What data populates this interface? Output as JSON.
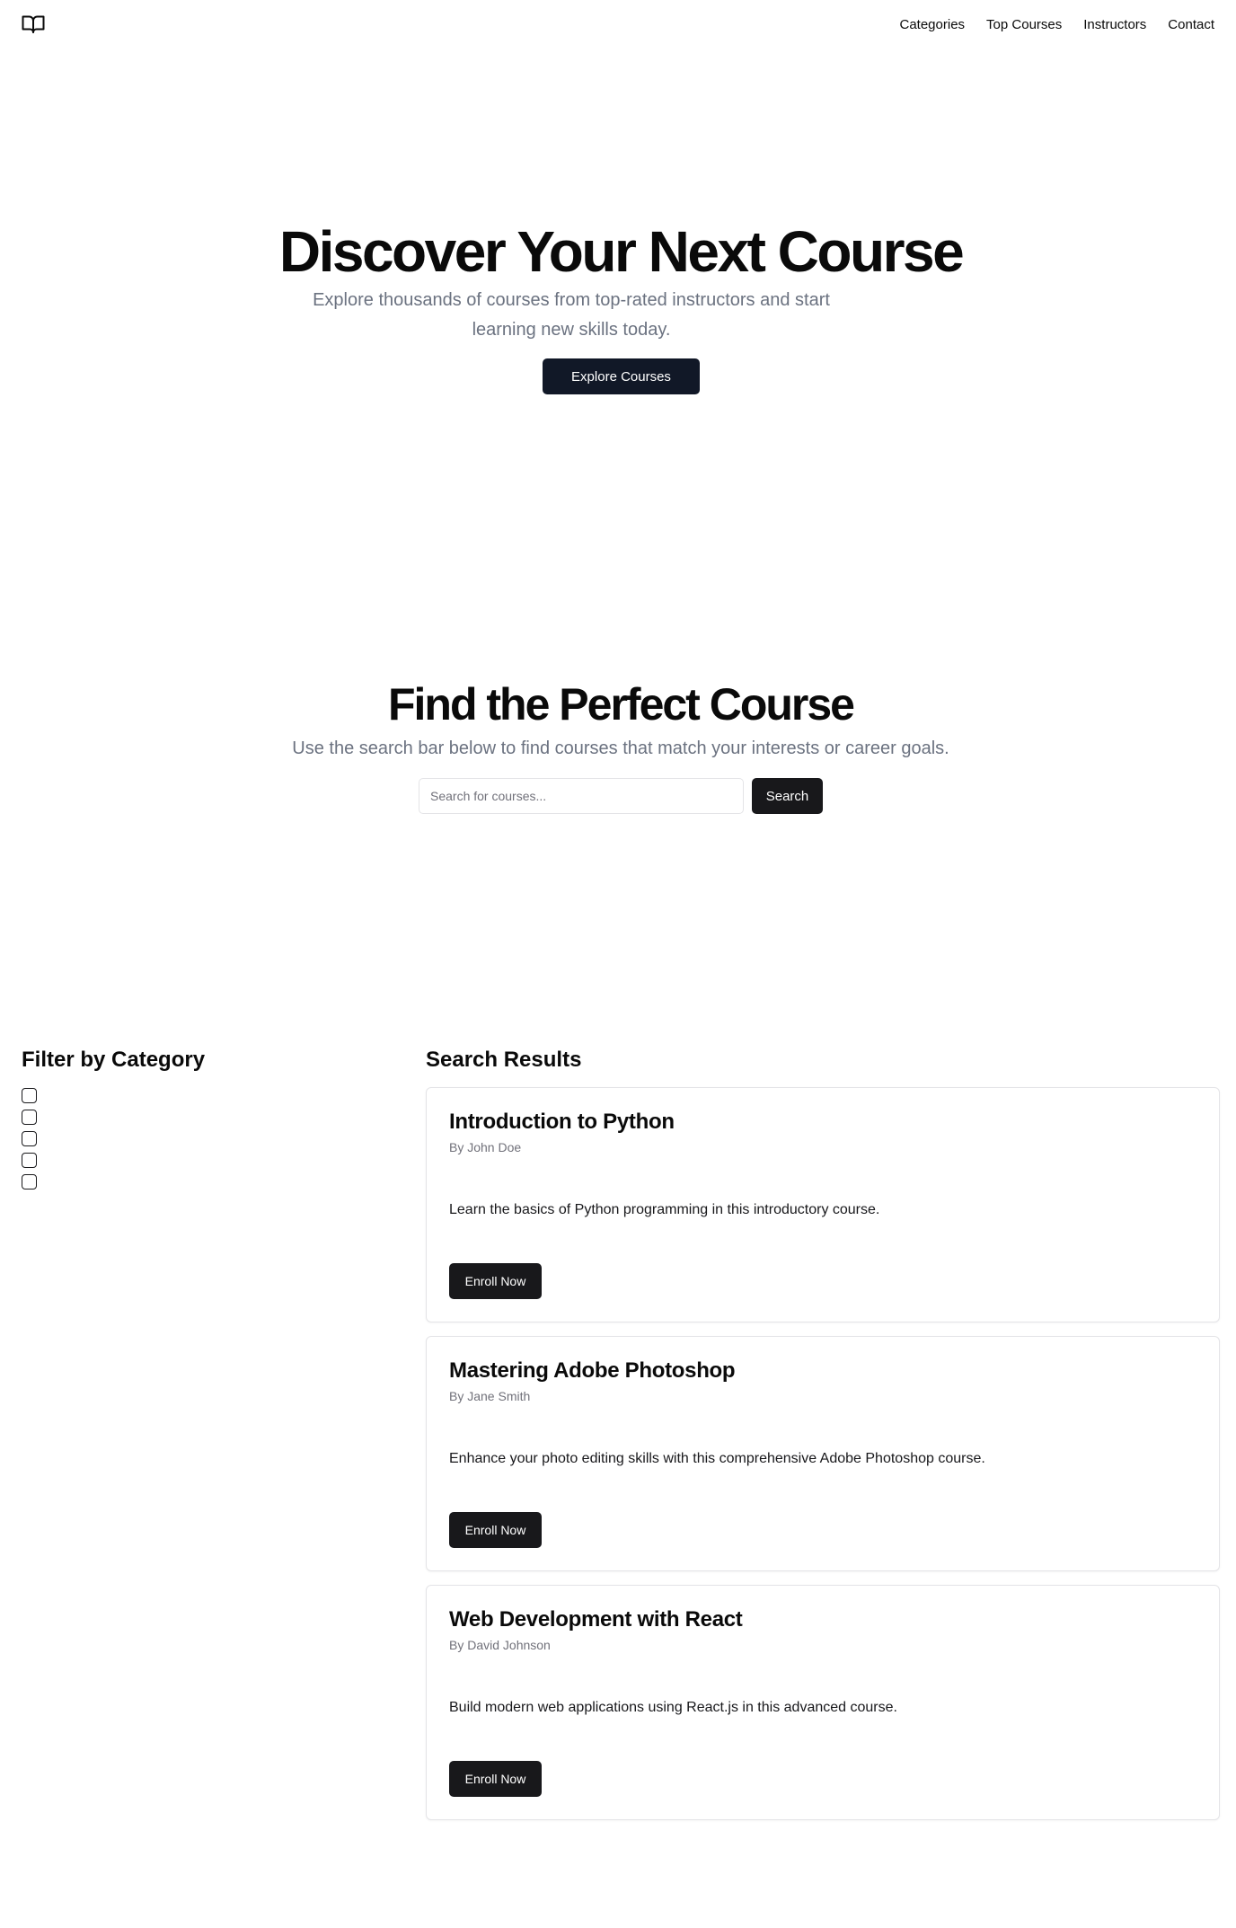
{
  "header": {
    "logo_icon": "book-open-icon",
    "nav": [
      {
        "label": "Categories"
      },
      {
        "label": "Top Courses"
      },
      {
        "label": "Instructors"
      },
      {
        "label": "Contact"
      }
    ]
  },
  "hero": {
    "title": "Discover Your Next Course",
    "subtitle": "Explore thousands of courses from top-rated instructors and start learning new skills today.",
    "button_label": "Explore Courses"
  },
  "search": {
    "title": "Find the Perfect Course",
    "subtitle": "Use the search bar below to find courses that match your interests or career goals.",
    "placeholder": "Search for courses...",
    "value": "",
    "button_label": "Search"
  },
  "filter": {
    "title": "Filter by Category",
    "checkbox_count": 5,
    "checked": [
      false,
      false,
      false,
      false,
      false
    ]
  },
  "results": {
    "title": "Search Results",
    "courses": [
      {
        "title": "Introduction to Python",
        "author": "By John Doe",
        "description": "Learn the basics of Python programming in this introductory course.",
        "button_label": "Enroll Now"
      },
      {
        "title": "Mastering Adobe Photoshop",
        "author": "By Jane Smith",
        "description": "Enhance your photo editing skills with this comprehensive Adobe Photoshop course.",
        "button_label": "Enroll Now"
      },
      {
        "title": "Web Development with React",
        "author": "By David Johnson",
        "description": "Build modern web applications using React.js in this advanced course.",
        "button_label": "Enroll Now"
      }
    ]
  },
  "colors": {
    "primary_button": "#111827",
    "secondary_button": "#18181b",
    "muted_text": "#6b7280",
    "border": "#e4e4e7"
  }
}
